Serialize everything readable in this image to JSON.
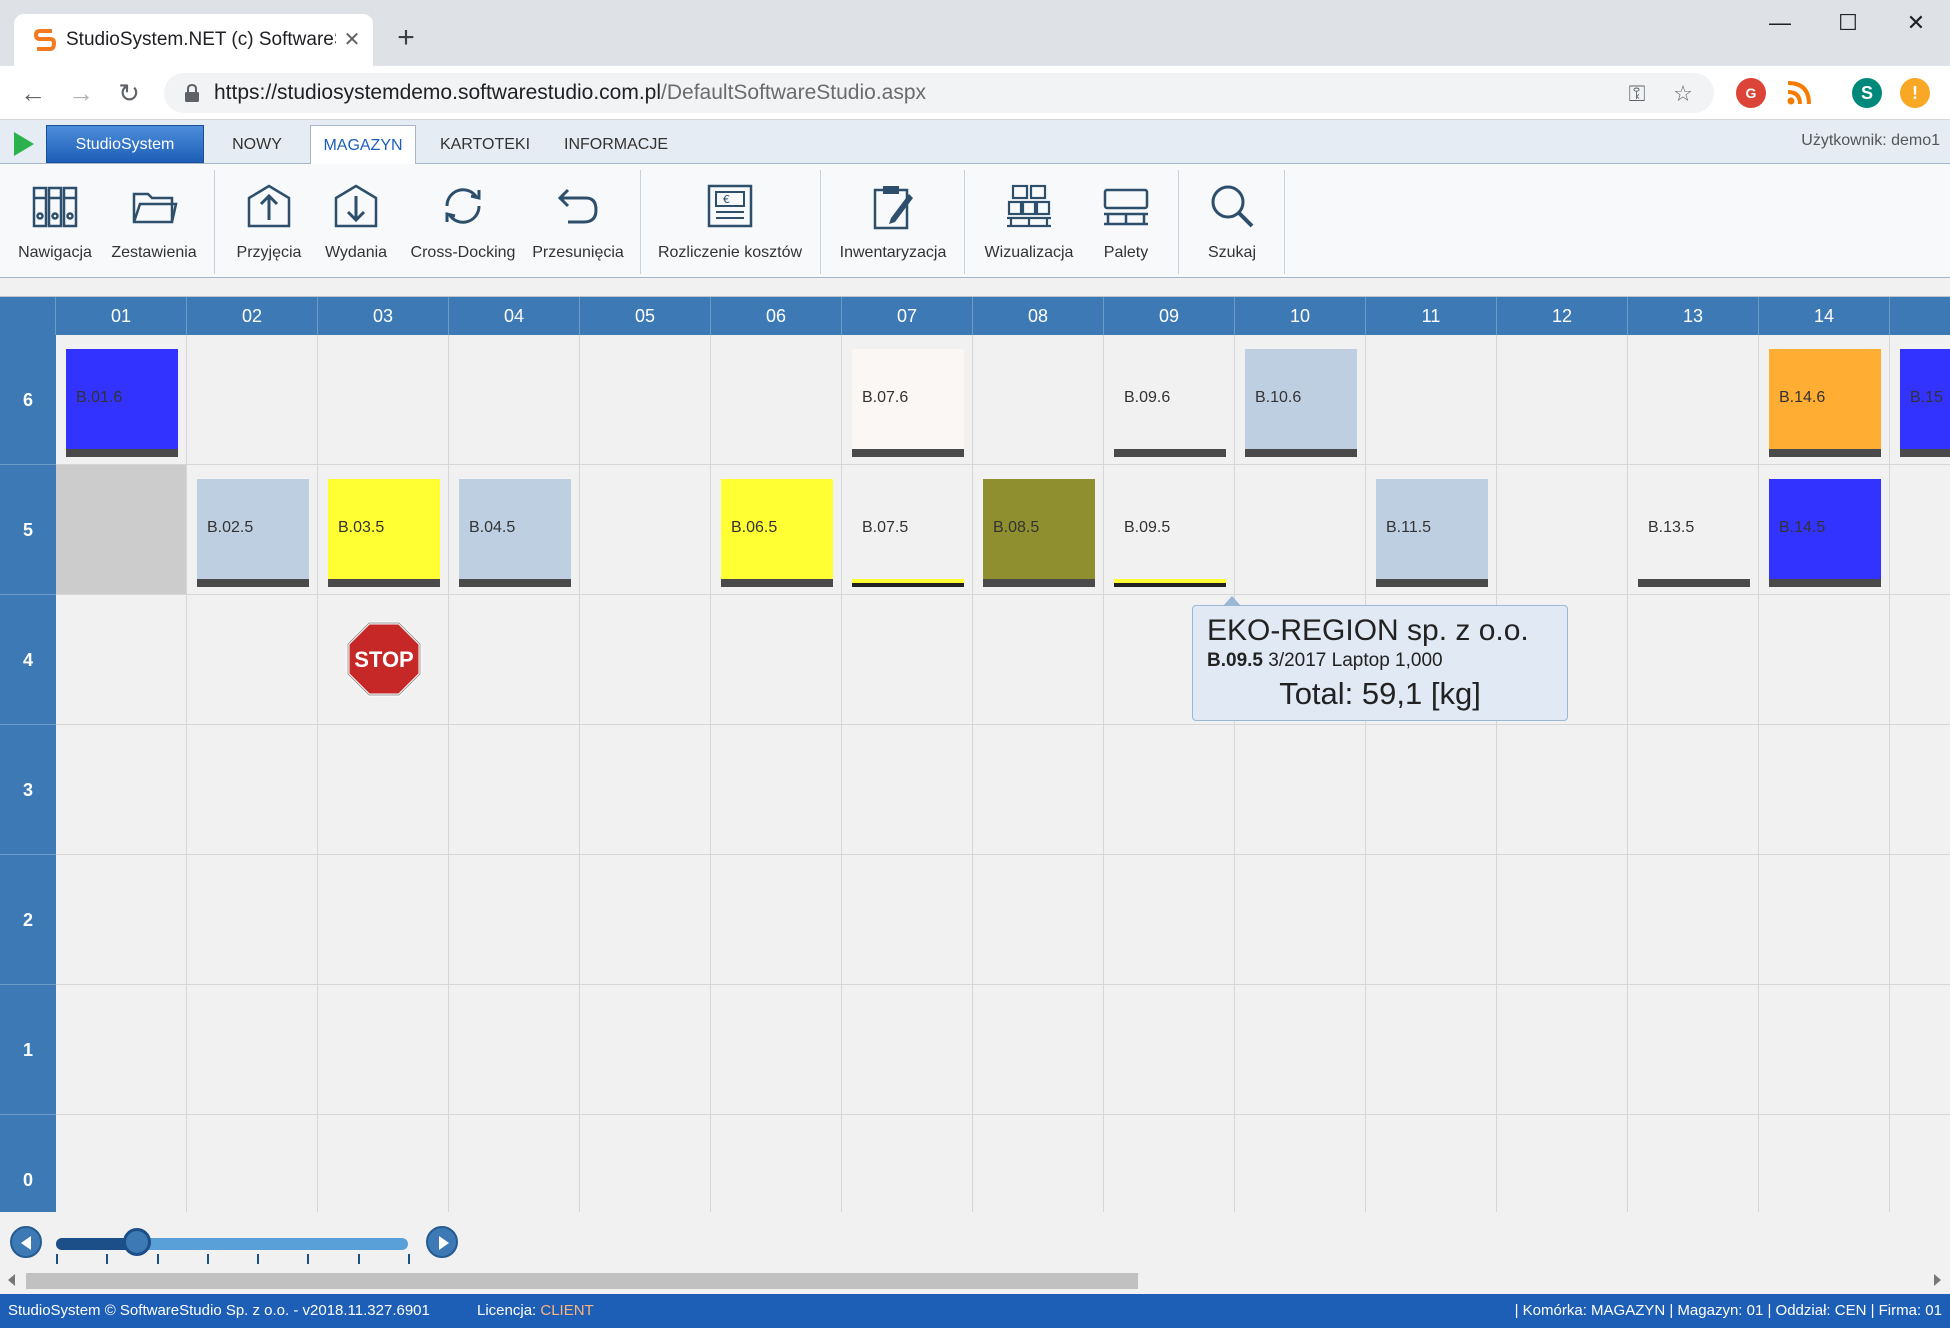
{
  "browser": {
    "tab_title": "StudioSystem.NET (c) SoftwareSt",
    "tab_close": "✕",
    "new_tab": "+",
    "url_host": "https://studiosystemdemo.softwarestudio.com.pl",
    "url_path": "/DefaultSoftwareStudio.aspx",
    "window_controls": [
      "—",
      "☐",
      "✕"
    ],
    "nav": [
      "←",
      "→",
      "↻"
    ],
    "omnibox_icons": [
      "key-icon",
      "star-icon"
    ],
    "extensions": [
      {
        "name": "google-plus-icon",
        "label": "G",
        "color": "#db4437"
      },
      {
        "name": "rss-icon",
        "label": "",
        "color": "#f57c00"
      },
      {
        "name": "profile-avatar",
        "label": "S",
        "color": "#00897b"
      },
      {
        "name": "update-icon",
        "label": "!",
        "color": "#f9a825"
      }
    ]
  },
  "app": {
    "brand_button": "StudioSystem",
    "menu_tabs": [
      "NOWY",
      "MAGAZYN",
      "KARTOTEKI",
      "INFORMACJE"
    ],
    "active_tab": "MAGAZYN",
    "user_label": "Użytkownik: demo1"
  },
  "ribbon": [
    {
      "label": "Nawigacja",
      "icon": "binders-icon"
    },
    {
      "label": "Zestawienia",
      "icon": "folder-icon"
    },
    {
      "label": "Przyjęcia",
      "icon": "receipt-icon"
    },
    {
      "label": "Wydania",
      "icon": "issue-icon"
    },
    {
      "label": "Cross-Docking",
      "icon": "cross-docking-icon"
    },
    {
      "label": "Przesunięcia",
      "icon": "move-icon"
    },
    {
      "label": "Rozliczenie kosztów",
      "icon": "cost-settlement-icon"
    },
    {
      "label": "Inwentaryzacja",
      "icon": "inventory-clipboard-icon"
    },
    {
      "label": "Wizualizacja",
      "icon": "visualization-boxes-icon"
    },
    {
      "label": "Palety",
      "icon": "pallets-icon"
    },
    {
      "label": "Szukaj",
      "icon": "search-icon"
    }
  ],
  "grid": {
    "columns": [
      "01",
      "02",
      "03",
      "04",
      "05",
      "06",
      "07",
      "08",
      "09",
      "10",
      "11",
      "12",
      "13",
      "14"
    ],
    "rows": [
      "6",
      "5",
      "4",
      "3",
      "2",
      "1",
      "0"
    ],
    "locations": [
      {
        "label": "B.01.6",
        "col": "01",
        "row": "6",
        "color": "#3333ff",
        "bar": "#4a4a4a"
      },
      {
        "label": "B.07.6",
        "col": "07",
        "row": "6",
        "color": "#fbf7f4",
        "bar": "#4a4a4a"
      },
      {
        "label": "B.09.6",
        "col": "09",
        "row": "6",
        "color": "#f1f1f1",
        "bar": "#4a4a4a"
      },
      {
        "label": "B.10.6",
        "col": "10",
        "row": "6",
        "color": "#bfcfe2",
        "bar": "#4a4a4a"
      },
      {
        "label": "B.14.6",
        "col": "14",
        "row": "6",
        "color": "#ffad33",
        "bar": "#4a4a4a"
      },
      {
        "label": "B.15",
        "col": "15",
        "row": "6",
        "color": "#3333ff",
        "bar": "#4a4a4a"
      },
      {
        "label": "B.02.5",
        "col": "02",
        "row": "5",
        "color": "#bfcfe2",
        "bar": "#4a4a4a"
      },
      {
        "label": "B.03.5",
        "col": "03",
        "row": "5",
        "color": "#ffff33",
        "bar": "#4a4a4a"
      },
      {
        "label": "B.04.5",
        "col": "04",
        "row": "5",
        "color": "#bfcfe2",
        "bar": "#4a4a4a"
      },
      {
        "label": "B.06.5",
        "col": "06",
        "row": "5",
        "color": "#ffff33",
        "bar": "#4a4a4a"
      },
      {
        "label": "B.07.5",
        "col": "07",
        "row": "5",
        "color": "#f1f1f1",
        "bar": "#ffff33"
      },
      {
        "label": "B.08.5",
        "col": "08",
        "row": "5",
        "color": "#8f8f2f",
        "bar": "#4a4a4a"
      },
      {
        "label": "B.09.5",
        "col": "09",
        "row": "5",
        "color": "#f1f1f1",
        "bar": "#ffff33"
      },
      {
        "label": "B.11.5",
        "col": "11",
        "row": "5",
        "color": "#bfcfe2",
        "bar": "#4a4a4a"
      },
      {
        "label": "B.13.5",
        "col": "13",
        "row": "5",
        "color": "#f1f1f1",
        "bar": "#4a4a4a"
      },
      {
        "label": "B.14.5",
        "col": "14",
        "row": "5",
        "color": "#3333ff",
        "bar": "#4a4a4a"
      }
    ],
    "blocked_cell": {
      "col": "01",
      "row": "5",
      "color": "#cccccc"
    },
    "stop_sign": {
      "col": "03",
      "row": "4",
      "label": "STOP"
    }
  },
  "tooltip": {
    "company": "EKO-REGION sp. z o.o.",
    "location": "B.09.5",
    "details": "3/2017 Laptop 1,000",
    "total": "Total: 59,1 [kg]"
  },
  "slider": {
    "value_fraction": 0.23,
    "ticks": 8
  },
  "statusbar": {
    "left": "StudioSystem © SoftwareStudio Sp. z o.o. - v2018.11.327.6901",
    "license_label": "Licencja: ",
    "license_value": "CLIENT",
    "right": "| Komórka: MAGAZYN | Magazyn: 01 | Oddział: CEN | Firma: 01"
  },
  "colors": {
    "accent": "#1d5fb7",
    "header": "#3d7ab5"
  }
}
